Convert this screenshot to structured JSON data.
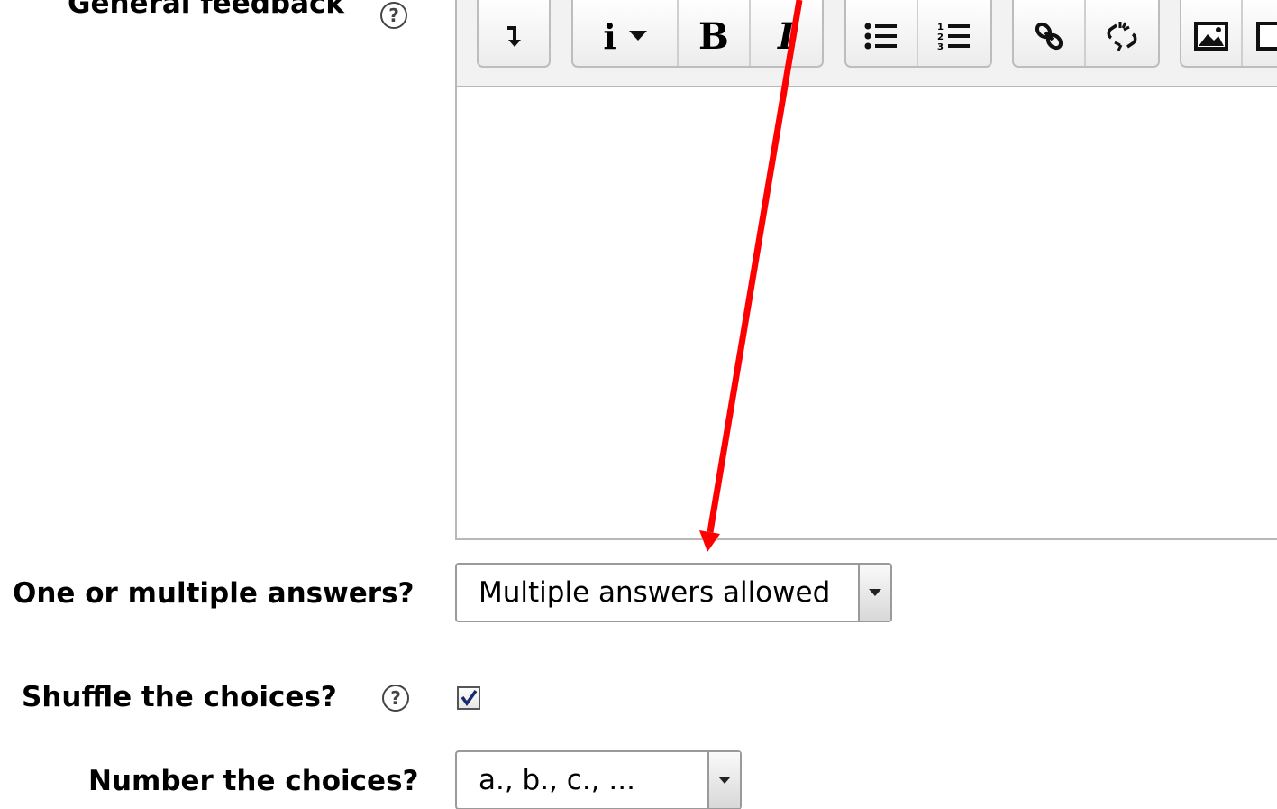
{
  "labels": {
    "general_feedback": "General feedback",
    "one_or_multiple": "One or multiple answers?",
    "shuffle": "Shuffle the choices?",
    "number_choices": "Number the choices?"
  },
  "fields": {
    "one_or_multiple_value": "Multiple answers allowed",
    "shuffle_checked": true,
    "number_choices_value": "a., b., c., ..."
  },
  "editor": {
    "toolbar_icons": [
      "collapse-icon",
      "paragraph-style-icon",
      "bold-icon",
      "italic-icon",
      "unordered-list-icon",
      "ordered-list-icon",
      "link-icon",
      "unlink-icon",
      "image-icon"
    ],
    "italic_text": "I",
    "bold_text": "B",
    "style_text": "i"
  },
  "annotation": {
    "arrow_color": "#ff0000"
  }
}
